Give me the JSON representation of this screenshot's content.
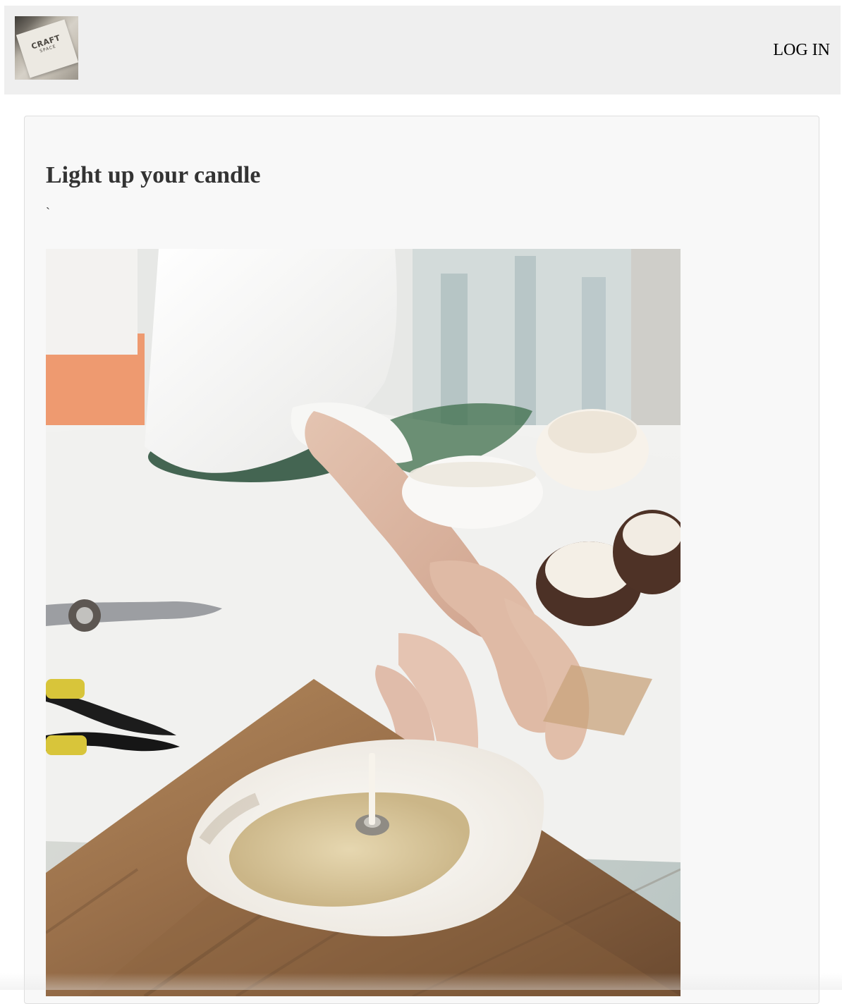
{
  "header": {
    "logo": {
      "main_text": "CRAFT",
      "sub_text": "SPACE"
    },
    "login_label": "LOG IN"
  },
  "main": {
    "title": "Light up your candle",
    "tick_text": "`",
    "image": {
      "subject": "hand placing candle wick into handmade candle"
    }
  },
  "colors": {
    "header_bg": "#efefef",
    "card_bg": "#f8f8f8",
    "text": "#333333",
    "link": "#000000"
  }
}
